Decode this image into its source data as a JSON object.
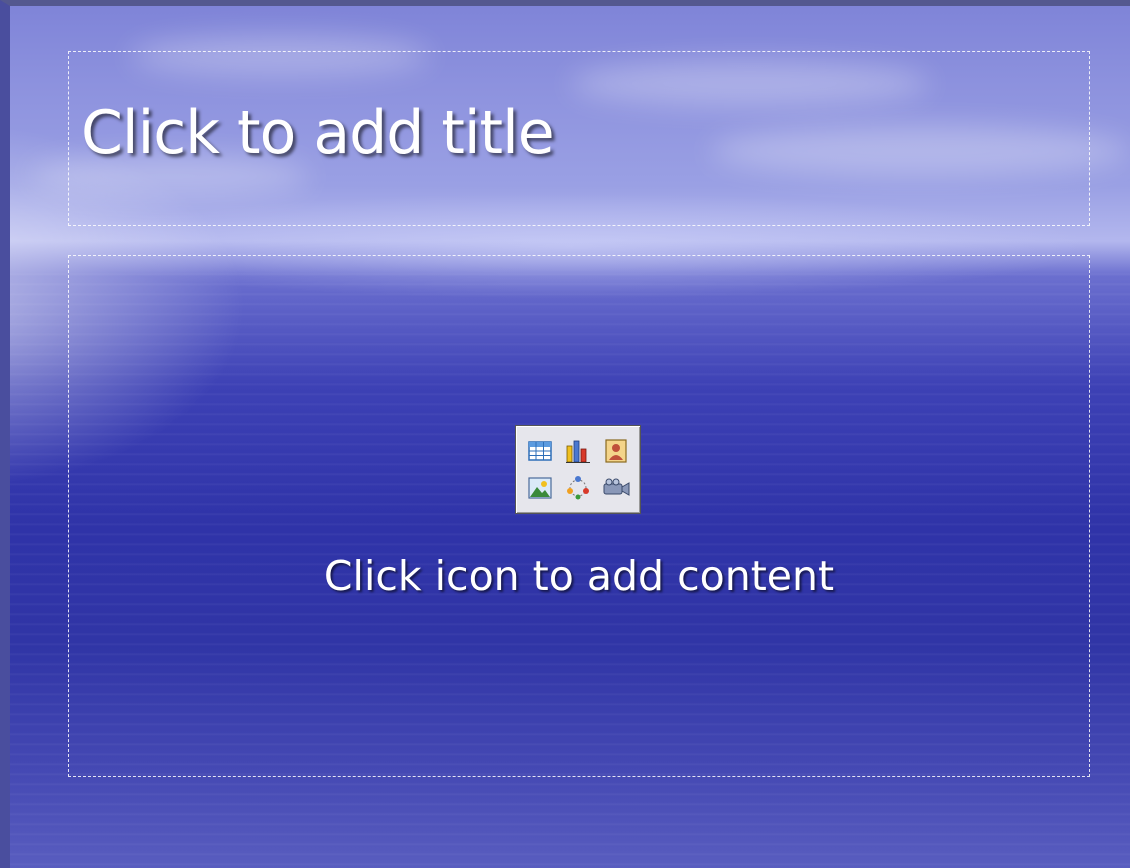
{
  "slide": {
    "title_placeholder": "Click to add title",
    "content_placeholder": "Click icon to add content",
    "content_icons": [
      {
        "name": "insert-table-icon"
      },
      {
        "name": "insert-chart-icon"
      },
      {
        "name": "insert-clip-art-icon"
      },
      {
        "name": "insert-picture-icon"
      },
      {
        "name": "insert-diagram-icon"
      },
      {
        "name": "insert-media-clip-icon"
      }
    ]
  },
  "colors": {
    "text": "#ffffff",
    "background": "#3035a6",
    "placeholder_border": "#ffffff"
  }
}
